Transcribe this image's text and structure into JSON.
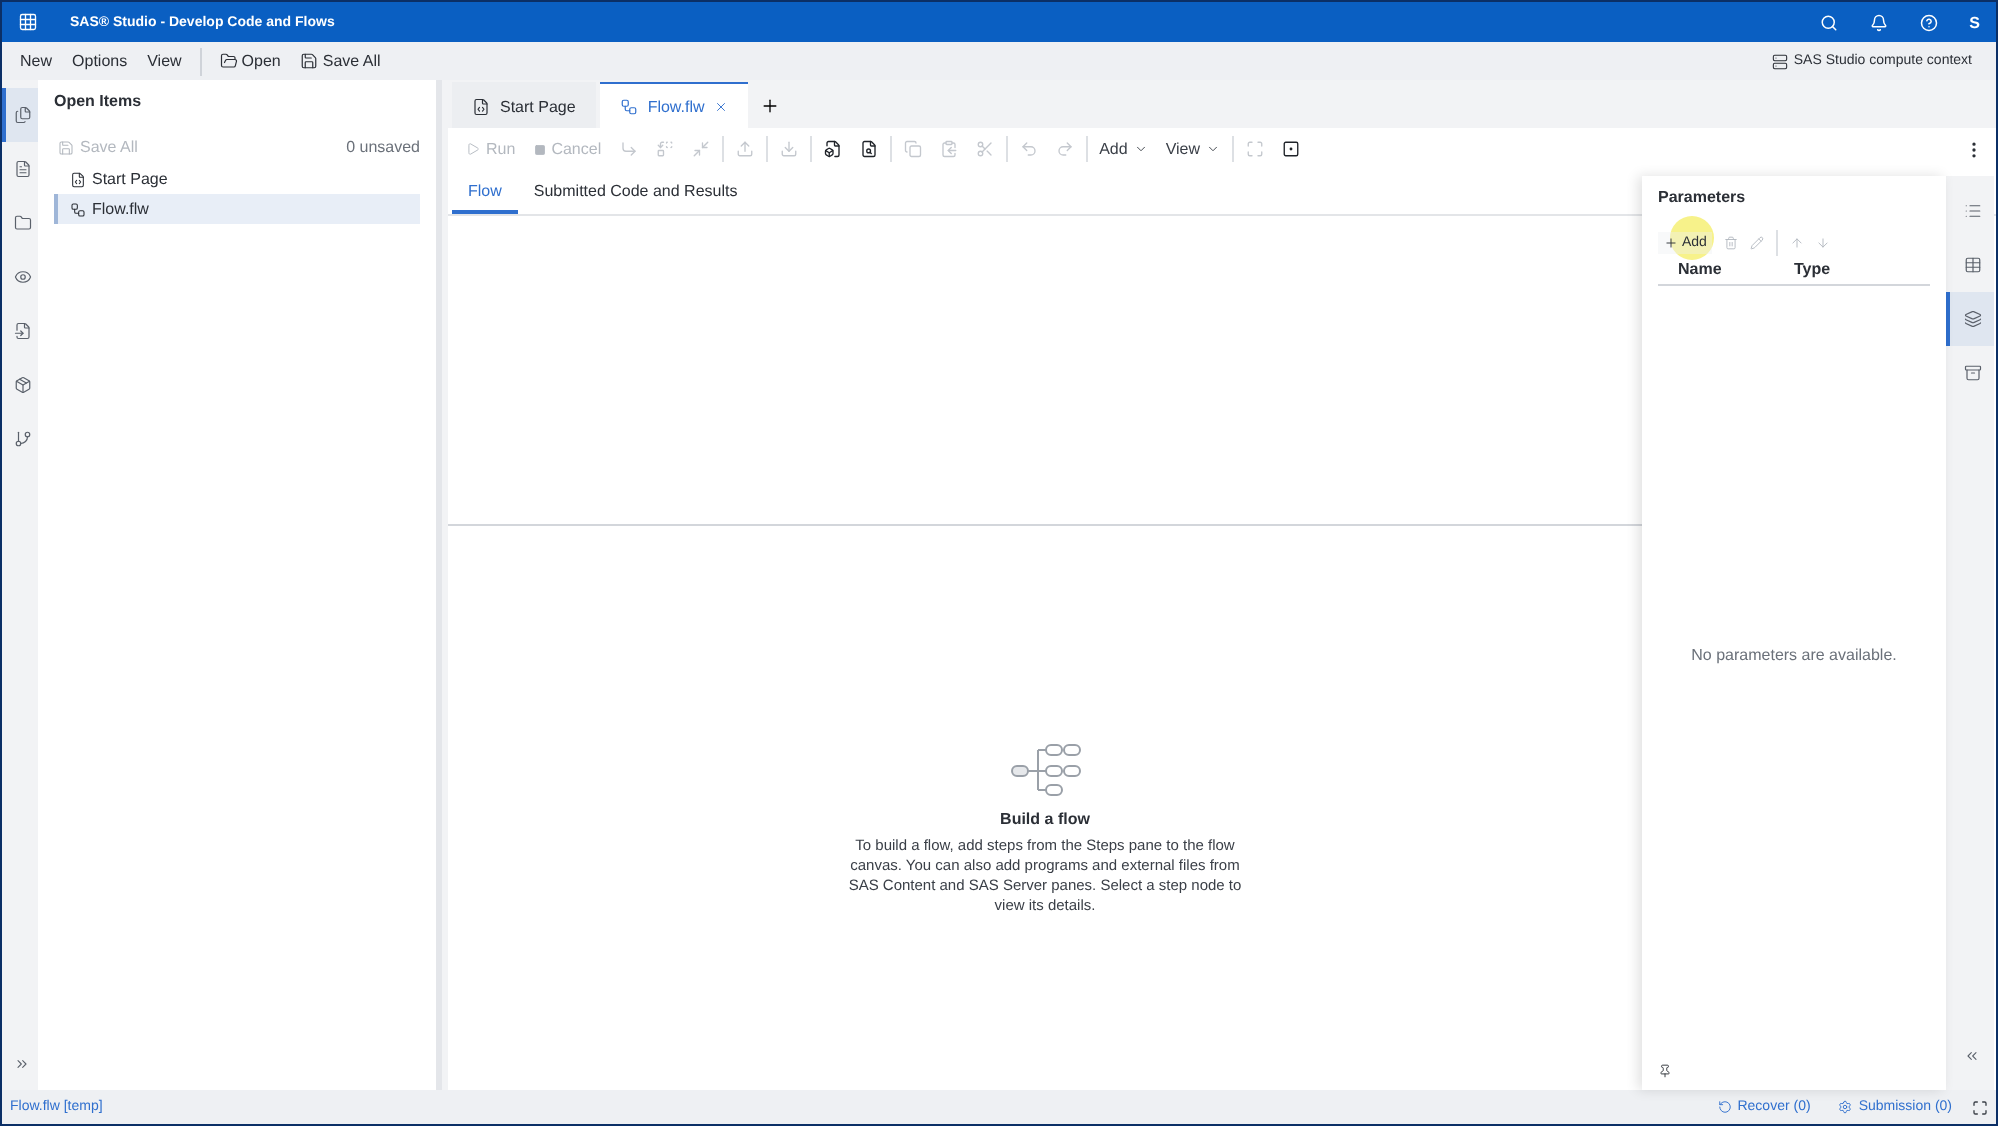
{
  "window": {
    "title": "SAS® Studio - Develop Code and Flows",
    "user_initial": "S"
  },
  "menu_bar": {
    "items": [
      {
        "label": "New",
        "kind": "menu"
      },
      {
        "label": "Options",
        "kind": "menu"
      },
      {
        "label": "View",
        "kind": "menu"
      },
      {
        "label": "Open",
        "kind": "action"
      },
      {
        "label": "Save All",
        "kind": "action"
      }
    ],
    "context": "SAS Studio compute context"
  },
  "left_rail": {
    "items": [
      {
        "selected": true
      },
      {
        "selected": false
      },
      {
        "selected": false
      },
      {
        "selected": false
      },
      {
        "selected": false
      },
      {
        "selected": false
      },
      {
        "selected": false
      }
    ]
  },
  "open_items": {
    "title": "Open Items",
    "save_all": {
      "label": "Save All",
      "disabled": true
    },
    "unsaved": "0 unsaved",
    "items": [
      {
        "label": "Start Page",
        "selected": false
      },
      {
        "label": "Flow.flw",
        "selected": true
      }
    ]
  },
  "tabs": [
    {
      "label": "Start Page",
      "selected": false,
      "closable": false
    },
    {
      "label": "Flow.flw",
      "selected": true,
      "closable": true
    }
  ],
  "toolbar": [
    {
      "kind": "text",
      "label": "Run",
      "disabled": true
    },
    {
      "kind": "text",
      "label": "Cancel",
      "disabled": true
    },
    {
      "kind": "icon",
      "disabled": true
    },
    {
      "kind": "icon",
      "disabled": true
    },
    {
      "kind": "icon",
      "disabled": true
    },
    {
      "kind": "separator"
    },
    {
      "kind": "icon",
      "disabled": true
    },
    {
      "kind": "separator"
    },
    {
      "kind": "icon",
      "disabled": true
    },
    {
      "kind": "separator"
    },
    {
      "kind": "icon",
      "disabled": false
    },
    {
      "kind": "icon",
      "disabled": false
    },
    {
      "kind": "separator"
    },
    {
      "kind": "icon",
      "disabled": true
    },
    {
      "kind": "icon",
      "disabled": true
    },
    {
      "kind": "icon",
      "disabled": true
    },
    {
      "kind": "separator"
    },
    {
      "kind": "icon",
      "disabled": true
    },
    {
      "kind": "icon",
      "disabled": true
    },
    {
      "kind": "separator"
    },
    {
      "kind": "menu",
      "label": "Add",
      "disabled": false
    },
    {
      "kind": "menu",
      "label": "View",
      "disabled": false
    },
    {
      "kind": "separator"
    },
    {
      "kind": "icon",
      "disabled": true
    },
    {
      "kind": "icon",
      "disabled": false
    }
  ],
  "subtabs": [
    {
      "label": "Flow",
      "selected": true
    },
    {
      "label": "Submitted Code and Results",
      "selected": false
    }
  ],
  "empty_state": {
    "title": "Build a flow",
    "text": "To build a flow, add steps from the Steps pane to the flow canvas. You can also add programs and external files from SAS Content and SAS Server panes. Select a step node to view its details."
  },
  "parameters": {
    "title": "Parameters",
    "add": {
      "label": "Add",
      "disabled": false
    },
    "columns": [
      "Name",
      "Type"
    ],
    "empty": "No parameters are available."
  },
  "right_rail": {
    "items": [
      {
        "selected": false
      },
      {
        "selected": false
      },
      {
        "selected": true
      },
      {
        "selected": false
      }
    ]
  },
  "status_bar": {
    "file": "Flow.flw [temp]",
    "recover": "Recover (0)",
    "submission": "Submission (0)"
  }
}
